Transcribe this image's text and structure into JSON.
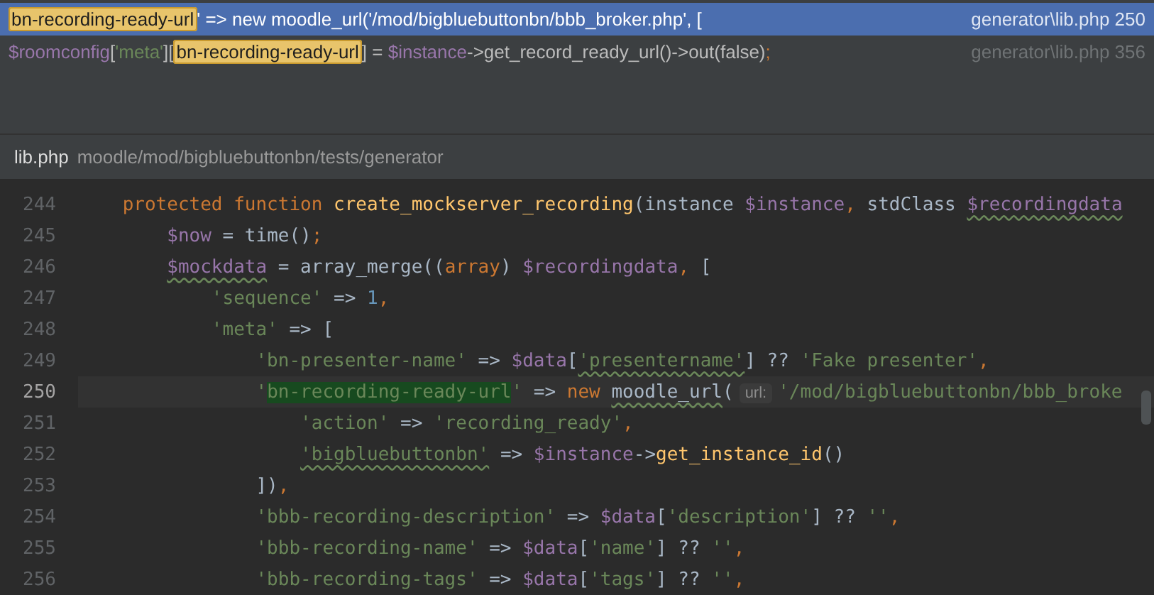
{
  "results": [
    {
      "selected": true,
      "segments": [
        {
          "t": "bn-recording-ready-url",
          "kind": "match"
        },
        {
          "t": "' => new moodle_url('/mod/bigbluebuttonbn/bbb_broker.php', [",
          "kind": "plain"
        }
      ],
      "location": "generator\\lib.php 250"
    },
    {
      "selected": false,
      "segments": [
        {
          "t": "$roomconfig",
          "kind": "var"
        },
        {
          "t": "[",
          "kind": "plain"
        },
        {
          "t": "'meta'",
          "kind": "string"
        },
        {
          "t": "][",
          "kind": "plain"
        },
        {
          "t": "bn-recording-ready-url",
          "kind": "match"
        },
        {
          "t": "] = ",
          "kind": "plain"
        },
        {
          "t": "$instance",
          "kind": "var"
        },
        {
          "t": "->get_record_ready_url()->out(false)",
          "kind": "plain"
        },
        {
          "t": ";",
          "kind": "keyword"
        }
      ],
      "location": "generator\\lib.php 356"
    }
  ],
  "breadcrumb": {
    "file": "lib.php",
    "path": "moodle/mod/bigbluebuttonbn/tests/generator"
  },
  "lines": [
    {
      "number": "244",
      "current": false,
      "tokens": [
        {
          "t": "    protected function ",
          "kind": "keyword"
        },
        {
          "t": "create_mockserver_recording",
          "kind": "func"
        },
        {
          "t": "(instance ",
          "kind": "plain"
        },
        {
          "t": "$instance",
          "kind": "var"
        },
        {
          "t": ", ",
          "kind": "keyword"
        },
        {
          "t": "stdClass ",
          "kind": "plain"
        },
        {
          "t": "$recordingdata",
          "kind": "var",
          "warning": true
        }
      ]
    },
    {
      "number": "245",
      "current": false,
      "tokens": [
        {
          "t": "        $now",
          "kind": "var"
        },
        {
          "t": " = time()",
          "kind": "plain"
        },
        {
          "t": ";",
          "kind": "keyword"
        }
      ]
    },
    {
      "number": "246",
      "current": false,
      "tokens": [
        {
          "t": "        $mockdata",
          "kind": "var",
          "warning": true
        },
        {
          "t": " = array_merge((",
          "kind": "plain"
        },
        {
          "t": "array",
          "kind": "keyword"
        },
        {
          "t": ") ",
          "kind": "plain"
        },
        {
          "t": "$recordingdata",
          "kind": "var"
        },
        {
          "t": ", ",
          "kind": "keyword"
        },
        {
          "t": "[",
          "kind": "plain"
        }
      ]
    },
    {
      "number": "247",
      "current": false,
      "tokens": [
        {
          "t": "            'sequence'",
          "kind": "string"
        },
        {
          "t": " => ",
          "kind": "plain"
        },
        {
          "t": "1",
          "kind": "number"
        },
        {
          "t": ",",
          "kind": "keyword"
        }
      ]
    },
    {
      "number": "248",
      "current": false,
      "tokens": [
        {
          "t": "            'meta'",
          "kind": "string"
        },
        {
          "t": " => [",
          "kind": "plain"
        }
      ]
    },
    {
      "number": "249",
      "current": false,
      "tokens": [
        {
          "t": "                'bn-presenter-name'",
          "kind": "string"
        },
        {
          "t": " => ",
          "kind": "plain"
        },
        {
          "t": "$data",
          "kind": "var"
        },
        {
          "t": "[",
          "kind": "plain"
        },
        {
          "t": "'presentername'",
          "kind": "string",
          "warning": true
        },
        {
          "t": "] ?? ",
          "kind": "plain"
        },
        {
          "t": "'Fake presenter'",
          "kind": "string"
        },
        {
          "t": ",",
          "kind": "keyword"
        }
      ]
    },
    {
      "number": "250",
      "current": true,
      "tokens": [
        {
          "t": "                '",
          "kind": "string"
        },
        {
          "t": "bn-recording-ready-url",
          "kind": "match"
        },
        {
          "t": "'",
          "kind": "string"
        },
        {
          "t": " => ",
          "kind": "plain"
        },
        {
          "t": "new ",
          "kind": "keyword"
        },
        {
          "t": "moodle_url",
          "kind": "plain",
          "warning": true
        },
        {
          "t": "(",
          "kind": "plain"
        },
        {
          "t": "url:",
          "kind": "hint"
        },
        {
          "t": "'/mod/bigbluebuttonbn/bbb_broke",
          "kind": "string"
        }
      ]
    },
    {
      "number": "251",
      "current": false,
      "tokens": [
        {
          "t": "                    'action'",
          "kind": "string"
        },
        {
          "t": " => ",
          "kind": "plain"
        },
        {
          "t": "'recording_ready'",
          "kind": "string"
        },
        {
          "t": ",",
          "kind": "keyword"
        }
      ]
    },
    {
      "number": "252",
      "current": false,
      "tokens": [
        {
          "t": "                    'bigbluebuttonbn'",
          "kind": "string",
          "warning": true
        },
        {
          "t": " => ",
          "kind": "plain"
        },
        {
          "t": "$instance",
          "kind": "var"
        },
        {
          "t": "->",
          "kind": "plain"
        },
        {
          "t": "get_instance_id",
          "kind": "func"
        },
        {
          "t": "()",
          "kind": "plain"
        }
      ]
    },
    {
      "number": "253",
      "current": false,
      "tokens": [
        {
          "t": "                ])",
          "kind": "plain"
        },
        {
          "t": ",",
          "kind": "keyword"
        }
      ]
    },
    {
      "number": "254",
      "current": false,
      "tokens": [
        {
          "t": "                'bbb-recording-description'",
          "kind": "string"
        },
        {
          "t": " => ",
          "kind": "plain"
        },
        {
          "t": "$data",
          "kind": "var"
        },
        {
          "t": "[",
          "kind": "plain"
        },
        {
          "t": "'description'",
          "kind": "string"
        },
        {
          "t": "] ?? ",
          "kind": "plain"
        },
        {
          "t": "''",
          "kind": "string"
        },
        {
          "t": ",",
          "kind": "keyword"
        }
      ]
    },
    {
      "number": "255",
      "current": false,
      "tokens": [
        {
          "t": "                'bbb-recording-name'",
          "kind": "string"
        },
        {
          "t": " => ",
          "kind": "plain"
        },
        {
          "t": "$data",
          "kind": "var"
        },
        {
          "t": "[",
          "kind": "plain"
        },
        {
          "t": "'name'",
          "kind": "string"
        },
        {
          "t": "] ?? ",
          "kind": "plain"
        },
        {
          "t": "''",
          "kind": "string"
        },
        {
          "t": ",",
          "kind": "keyword"
        }
      ]
    },
    {
      "number": "256",
      "current": false,
      "tokens": [
        {
          "t": "                'bbb-recording-tags'",
          "kind": "string"
        },
        {
          "t": " => ",
          "kind": "plain"
        },
        {
          "t": "$data",
          "kind": "var"
        },
        {
          "t": "[",
          "kind": "plain"
        },
        {
          "t": "'tags'",
          "kind": "string"
        },
        {
          "t": "] ?? ",
          "kind": "plain"
        },
        {
          "t": "''",
          "kind": "string"
        },
        {
          "t": ",",
          "kind": "keyword"
        }
      ]
    }
  ]
}
